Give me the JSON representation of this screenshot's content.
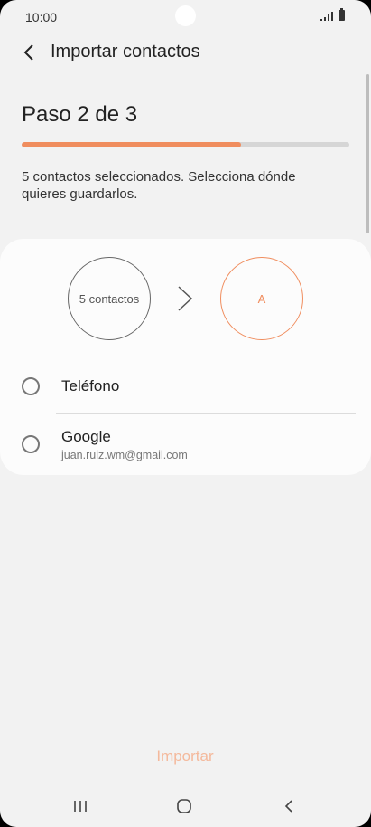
{
  "status_bar": {
    "time": "10:00",
    "signal_icon": "signal-icon",
    "battery_icon": "battery-icon"
  },
  "header": {
    "title": "Importar contactos",
    "back_icon": "chevron-left-icon"
  },
  "step": {
    "label": "Paso 2 de 3",
    "progress": 0.67
  },
  "instructions": "5 contactos seleccionados. Selecciona dónde quieres guardarlos.",
  "transfer": {
    "source": "5 contactos",
    "target": "A",
    "arrow_icon": "chevron-right-icon"
  },
  "options": [
    {
      "label": "Teléfono",
      "sublabel": "",
      "selected": false
    },
    {
      "label": "Google",
      "sublabel": "juan.ruiz.wm@gmail.com",
      "selected": false
    }
  ],
  "actions": {
    "import_label": "Importar"
  },
  "nav": {
    "recents_icon": "recents-icon",
    "home_icon": "home-icon",
    "back_icon": "back-icon"
  },
  "colors": {
    "accent": "#f08d5e",
    "accent_disabled": "#f4b99c",
    "background": "#f2f2f2",
    "card": "#fcfcfc"
  }
}
